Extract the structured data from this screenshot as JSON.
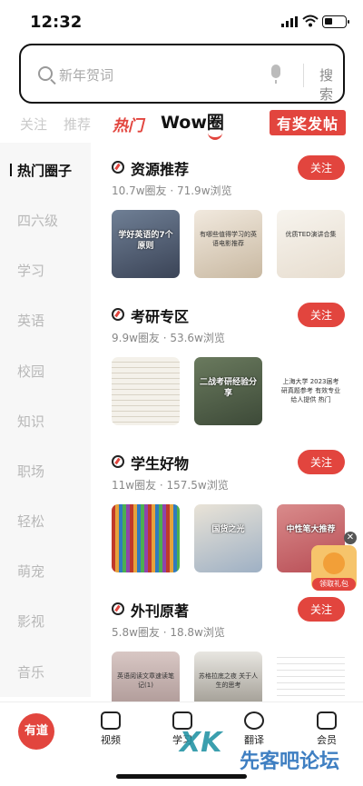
{
  "status": {
    "time": "12:32"
  },
  "search": {
    "placeholder": "新年贺词",
    "button": "搜索"
  },
  "tabs": [
    "关注",
    "推荐",
    "热门",
    "Wow圈",
    "有奖发帖"
  ],
  "sidebar": [
    "热门圈子",
    "四六级",
    "学习",
    "英语",
    "校园",
    "知识",
    "职场",
    "轻松",
    "萌宠",
    "影视",
    "音乐"
  ],
  "sections": [
    {
      "title": "资源推荐",
      "stats": "10.7w圈友 · 71.9w浏览",
      "follow": "关注",
      "thumbs": [
        "学好英语的7个原则",
        "有哪些值得学习的英语电影推荐",
        "优质TED演讲合集"
      ]
    },
    {
      "title": "考研专区",
      "stats": "9.9w圈友 · 53.6w浏览",
      "follow": "关注",
      "thumbs": [
        "",
        "二战考研经验分享",
        "上海大学 2023届考研真题参考 有效专业给人提供 热门"
      ]
    },
    {
      "title": "学生好物",
      "stats": "11w圈友 · 157.5w浏览",
      "follow": "关注",
      "thumbs": [
        "",
        "国货之光",
        "中性笔大推荐"
      ]
    },
    {
      "title": "外刊原著",
      "stats": "5.8w圈友 · 18.8w浏览",
      "follow": "关注",
      "thumbs": [
        "英语阅读文章速读笔记(1)",
        "苏格拉底之夜 关于人生的思考",
        ""
      ]
    }
  ],
  "float": {
    "close": "✕",
    "label": "领取礼包"
  },
  "tabbar": [
    "有道",
    "视频",
    "学习",
    "翻译",
    "会员"
  ],
  "watermark": {
    "main": "XK",
    "sub": "先客吧论坛"
  }
}
